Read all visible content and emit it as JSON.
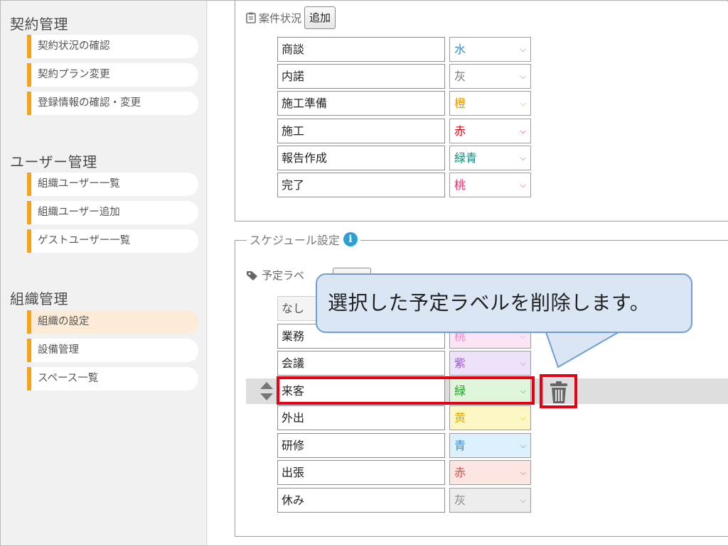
{
  "sidebar": {
    "sections": [
      {
        "title": "契約管理",
        "items": [
          "契約状況の確認",
          "契約プラン変更",
          "登録情報の確認・変更"
        ]
      },
      {
        "title": "ユーザー管理",
        "items": [
          "組織ユーザー一覧",
          "組織ユーザー追加",
          "ゲストユーザー一覧"
        ]
      },
      {
        "title": "組織管理",
        "items": [
          "組織の設定",
          "設備管理",
          "スペース一覧"
        ]
      }
    ],
    "active_item": "組織の設定"
  },
  "project_status": {
    "label": "案件状況",
    "add_button": "追加",
    "rows": [
      {
        "name": "商談",
        "color": "水",
        "color_hex": "#2b8fd8"
      },
      {
        "name": "内諾",
        "color": "灰",
        "color_hex": "#777777"
      },
      {
        "name": "施工準備",
        "color": "橙",
        "color_hex": "#f39800"
      },
      {
        "name": "施工",
        "color": "赤",
        "color_hex": "#e60012"
      },
      {
        "name": "報告作成",
        "color": "緑青",
        "color_hex": "#138a7a"
      },
      {
        "name": "完了",
        "color": "桃",
        "color_hex": "#e4316f"
      }
    ]
  },
  "schedule_settings": {
    "legend": "スケジュール設定",
    "label_header": "予定ラベ",
    "rows": [
      {
        "name": "なし",
        "color": "",
        "color_hex": "#333333",
        "bg_hex": "#f4f4f4"
      },
      {
        "name": "業務",
        "color": "桃",
        "color_hex": "#f08ac8",
        "bg_hex": "#fbe4f3"
      },
      {
        "name": "会議",
        "color": "紫",
        "color_hex": "#a05ad8",
        "bg_hex": "#eee2fb"
      },
      {
        "name": "来客",
        "color": "緑",
        "color_hex": "#23a02a",
        "bg_hex": "#e0f6dc"
      },
      {
        "name": "外出",
        "color": "黄",
        "color_hex": "#e0b000",
        "bg_hex": "#fdf6c5"
      },
      {
        "name": "研修",
        "color": "青",
        "color_hex": "#2b8fd8",
        "bg_hex": "#dcf0fb"
      },
      {
        "name": "出張",
        "color": "赤",
        "color_hex": "#e8463a",
        "bg_hex": "#fde6e1"
      },
      {
        "name": "休み",
        "color": "灰",
        "color_hex": "#888888",
        "bg_hex": "#ededed"
      }
    ]
  },
  "callout": {
    "text": "選択した予定ラベルを削除します。"
  },
  "colors": {
    "accent": "#f6a31a",
    "highlight": "#e60012",
    "callout_border": "#6f9ed6"
  }
}
